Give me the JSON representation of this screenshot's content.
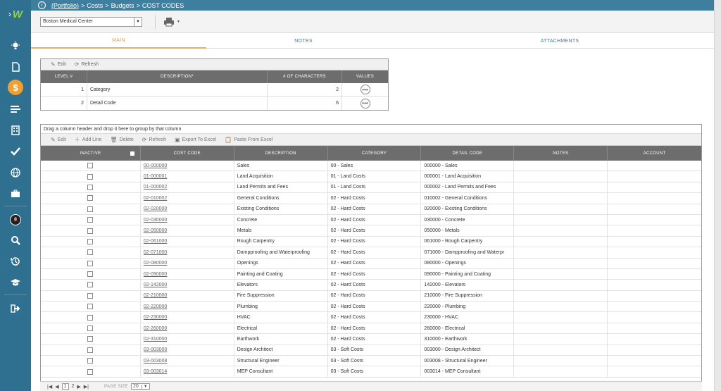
{
  "breadcrumb": {
    "portfolio": "(Portfolio)",
    "sep1": ">",
    "costs": "Costs",
    "sep2": ">",
    "budgets": "Budgets",
    "sep3": ">",
    "page": "COST CODES"
  },
  "project": {
    "selected": "Boston Medical Center"
  },
  "tabs": [
    {
      "label": "MAIN"
    },
    {
      "label": "NOTES"
    },
    {
      "label": "ATTACHMENTS"
    }
  ],
  "levels": {
    "toolbar": {
      "edit": "Edit",
      "refresh": "Refresh"
    },
    "headers": {
      "level": "LEVEL #",
      "description": "DESCRIPTION*",
      "chars": "# OF CHARACTERS",
      "values": "VALUES"
    },
    "rows": [
      {
        "level": "1",
        "description": "Category",
        "chars": "2"
      },
      {
        "level": "2",
        "description": "Detail Code",
        "chars": "6"
      }
    ]
  },
  "grid": {
    "group_hint": "Drag a column header and drop it here to group by that column",
    "toolbar": {
      "edit": "Edit",
      "add": "Add Line",
      "delete": "Delete",
      "refresh": "Refresh",
      "export": "Export To Excel",
      "paste": "Paste From Excel"
    },
    "headers": {
      "inactive": "INACTIVE",
      "code": "COST CODE",
      "description": "DESCRIPTION",
      "category": "CATEGORY",
      "detail": "DETAIL CODE",
      "notes": "NOTES",
      "account": "ACCOUNT"
    },
    "rows": [
      {
        "code": "00-000000",
        "description": "Sales",
        "category": "00 - Sales",
        "detail": "000000 - Sales"
      },
      {
        "code": "01-000001",
        "description": "Land Acquisition",
        "category": "01 - Land Costs",
        "detail": "000001 - Land Acquisition"
      },
      {
        "code": "01-000002",
        "description": "Land Permits and Fees",
        "category": "01 - Land Costs",
        "detail": "000002 - Land Permits and Fees"
      },
      {
        "code": "02-010002",
        "description": "General Conditions",
        "category": "02 - Hard Costs",
        "detail": "010002 - General Conditions"
      },
      {
        "code": "02-020000",
        "description": "Existing Conditions",
        "category": "02 - Hard Costs",
        "detail": "020000 - Existing Conditions"
      },
      {
        "code": "02-030000",
        "description": "Concrete",
        "category": "02 - Hard Costs",
        "detail": "030000 - Concrete"
      },
      {
        "code": "02-050000",
        "description": "Metals",
        "category": "02 - Hard Costs",
        "detail": "050000 - Metals"
      },
      {
        "code": "02-061000",
        "description": "Rough Carpentry",
        "category": "02 - Hard Costs",
        "detail": "061000 - Rough Carpentry"
      },
      {
        "code": "02-071000",
        "description": "Dampproofing and Waterproofing",
        "category": "02 - Hard Costs",
        "detail": "071000 - Dampproofing and Waterpr"
      },
      {
        "code": "02-080000",
        "description": "Openings",
        "category": "02 - Hard Costs",
        "detail": "080000 - Openings"
      },
      {
        "code": "02-090000",
        "description": "Painting and Coating",
        "category": "02 - Hard Costs",
        "detail": "090000 - Painting and Coating"
      },
      {
        "code": "02-142000",
        "description": "Elevators",
        "category": "02 - Hard Costs",
        "detail": "142000 - Elevators"
      },
      {
        "code": "02-210000",
        "description": "Fire Suppression",
        "category": "02 - Hard Costs",
        "detail": "210000 - Fire Suppression"
      },
      {
        "code": "02-220000",
        "description": "Plumbing",
        "category": "02 - Hard Costs",
        "detail": "220000 - Plumbing"
      },
      {
        "code": "02-230000",
        "description": "HVAC",
        "category": "02 - Hard Costs",
        "detail": "230000 - HVAC"
      },
      {
        "code": "02-260000",
        "description": "Electrical",
        "category": "02 - Hard Costs",
        "detail": "260000 - Electrical"
      },
      {
        "code": "02-310000",
        "description": "Earthwork",
        "category": "02 - Hard Costs",
        "detail": "310000 - Earthwork"
      },
      {
        "code": "03-003000",
        "description": "Design Architect",
        "category": "03 - Soft Costs",
        "detail": "003000 - Design Architect"
      },
      {
        "code": "03-003008",
        "description": "Structural Engineer",
        "category": "03 - Soft Costs",
        "detail": "003008 - Structural Engineer"
      },
      {
        "code": "03-003014",
        "description": "MEP Consultant",
        "category": "03 - Soft Costs",
        "detail": "003014 - MEP Consultant"
      }
    ]
  },
  "pager": {
    "page1": "1",
    "page2": "2",
    "size_label": "PAGE SIZE",
    "size": "20"
  },
  "colors": {
    "sidebar": "#2f6f8f",
    "topbar": "#3e7fa0",
    "accent": "#f0a030",
    "header": "#6d6d6d"
  }
}
